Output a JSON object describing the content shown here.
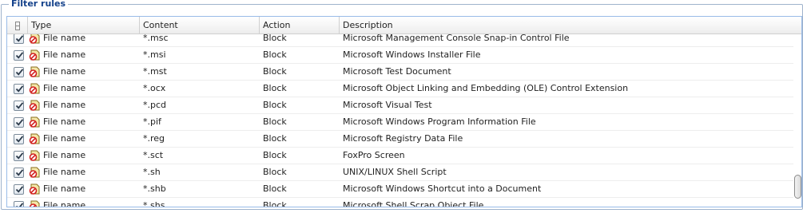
{
  "panel": {
    "legend": "Filter rules"
  },
  "grid": {
    "columns": [
      {
        "key": "select",
        "label": "",
        "icon": "select-all-checkbox-icon"
      },
      {
        "key": "type",
        "label": "Type"
      },
      {
        "key": "content",
        "label": "Content"
      },
      {
        "key": "action",
        "label": "Action"
      },
      {
        "key": "description",
        "label": "Description"
      }
    ],
    "rows": [
      {
        "checked": true,
        "type": "File name",
        "content": "*.msc",
        "action": "Block",
        "description": "Microsoft Management Console Snap-in Control File"
      },
      {
        "checked": true,
        "type": "File name",
        "content": "*.msi",
        "action": "Block",
        "description": "Microsoft Windows Installer File"
      },
      {
        "checked": true,
        "type": "File name",
        "content": "*.mst",
        "action": "Block",
        "description": "Microsoft Test Document"
      },
      {
        "checked": true,
        "type": "File name",
        "content": "*.ocx",
        "action": "Block",
        "description": "Microsoft Object Linking and Embedding (OLE) Control Extension"
      },
      {
        "checked": true,
        "type": "File name",
        "content": "*.pcd",
        "action": "Block",
        "description": "Microsoft Visual Test"
      },
      {
        "checked": true,
        "type": "File name",
        "content": "*.pif",
        "action": "Block",
        "description": "Microsoft Windows Program Information File"
      },
      {
        "checked": true,
        "type": "File name",
        "content": "*.reg",
        "action": "Block",
        "description": "Microsoft Registry Data File"
      },
      {
        "checked": true,
        "type": "File name",
        "content": "*.sct",
        "action": "Block",
        "description": "FoxPro Screen"
      },
      {
        "checked": true,
        "type": "File name",
        "content": "*.sh",
        "action": "Block",
        "description": "UNIX/LINUX Shell Script"
      },
      {
        "checked": true,
        "type": "File name",
        "content": "*.shb",
        "action": "Block",
        "description": "Microsoft Windows Shortcut into a Document"
      },
      {
        "checked": true,
        "type": "File name",
        "content": "*.shs",
        "action": "Block",
        "description": "Microsoft Shell Scrap Object File"
      }
    ],
    "row_icon": "file-name-filter-icon",
    "colors": {
      "header_border": "#99bbe8",
      "legend_text": "#15428b",
      "row_divider": "#ededed"
    }
  }
}
